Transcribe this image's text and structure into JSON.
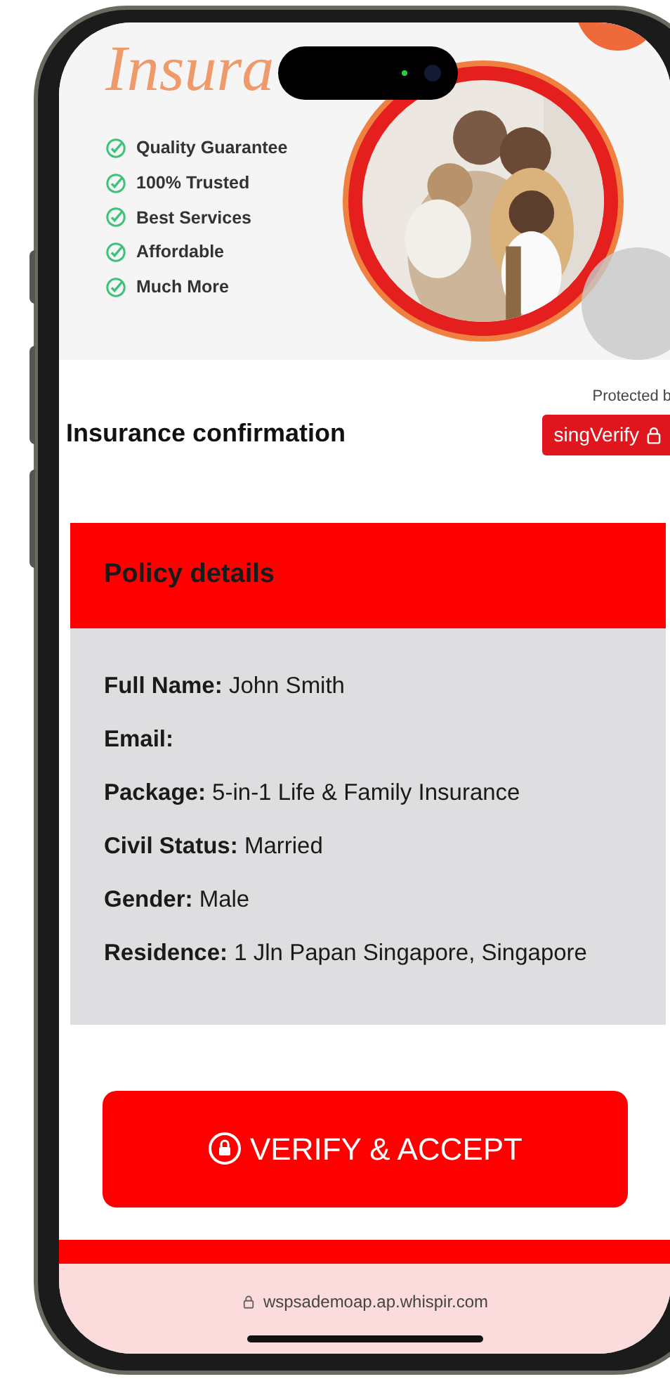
{
  "banner": {
    "title": "Insura",
    "features": [
      "Quality Guarantee",
      "100% Trusted",
      "Best Services",
      "Affordable",
      "Much More"
    ]
  },
  "protection": {
    "caption": "Protected b",
    "badge": "singVerify"
  },
  "heading": "Insurance confirmation",
  "policy": {
    "title": "Policy details",
    "fields": [
      {
        "label": "Full Name:",
        "value": "John Smith"
      },
      {
        "label": "Email:"
      },
      {
        "label": "Package:",
        "value": "5-in-1 Life & Family Insurance"
      },
      {
        "label": "Civil Status:",
        "value": "Married"
      },
      {
        "label": "Gender:",
        "value": "Male"
      },
      {
        "label": "Residence:",
        "value": "1 Jln Papan Singapore, Singapore"
      }
    ]
  },
  "action_button": "VERIFY & ACCEPT",
  "browser": {
    "url": "wspsademoap.ap.whispir.com"
  }
}
